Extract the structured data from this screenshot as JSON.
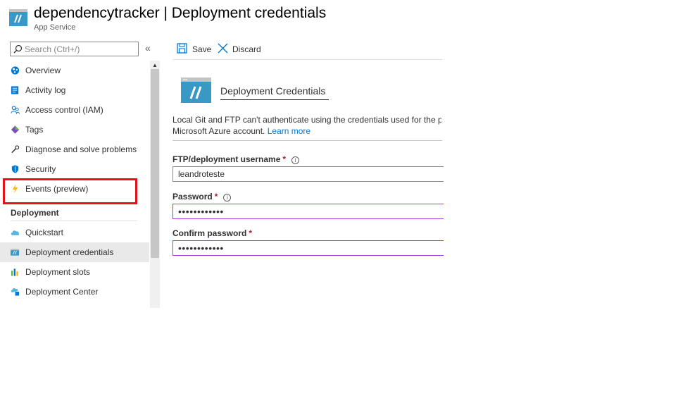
{
  "header": {
    "resource_name": "dependencytracker",
    "page_title": "| Deployment credentials",
    "subtitle": "App Service"
  },
  "search": {
    "placeholder": "Search (Ctrl+/)"
  },
  "sidebar": {
    "items": [
      {
        "label": "Overview",
        "icon": "overview-icon"
      },
      {
        "label": "Activity log",
        "icon": "activity-log-icon"
      },
      {
        "label": "Access control (IAM)",
        "icon": "people-icon"
      },
      {
        "label": "Tags",
        "icon": "tag-icon"
      },
      {
        "label": "Diagnose and solve problems",
        "icon": "wrench-icon"
      },
      {
        "label": "Security",
        "icon": "shield-icon"
      },
      {
        "label": "Events (preview)",
        "icon": "lightning-icon"
      }
    ],
    "section_header": "Deployment",
    "deployment_items": [
      {
        "label": "Quickstart",
        "icon": "cloud-icon"
      },
      {
        "label": "Deployment credentials",
        "icon": "app-service-icon",
        "active": true
      },
      {
        "label": "Deployment slots",
        "icon": "slots-icon"
      },
      {
        "label": "Deployment Center",
        "icon": "deployment-center-icon"
      }
    ]
  },
  "toolbar": {
    "save_label": "Save",
    "discard_label": "Discard"
  },
  "content": {
    "section_title": "Deployment Credentials",
    "description_line1": "Local Git and FTP can't authenticate using the credentials used for the pc",
    "description_line2_prefix": "Microsoft Azure account. ",
    "learn_more": "Learn more",
    "username_label": "FTP/deployment username",
    "username_value": "leandroteste",
    "password_label": "Password",
    "password_value": "••••••••••••",
    "confirm_label": "Confirm password",
    "confirm_value": "••••••••••••",
    "required_marker": "*",
    "info_glyph": "i"
  },
  "colors": {
    "accent": "#0078d4",
    "highlight": "#e4111c",
    "focus_border": "#a73ad4",
    "required": "#a4262c"
  }
}
